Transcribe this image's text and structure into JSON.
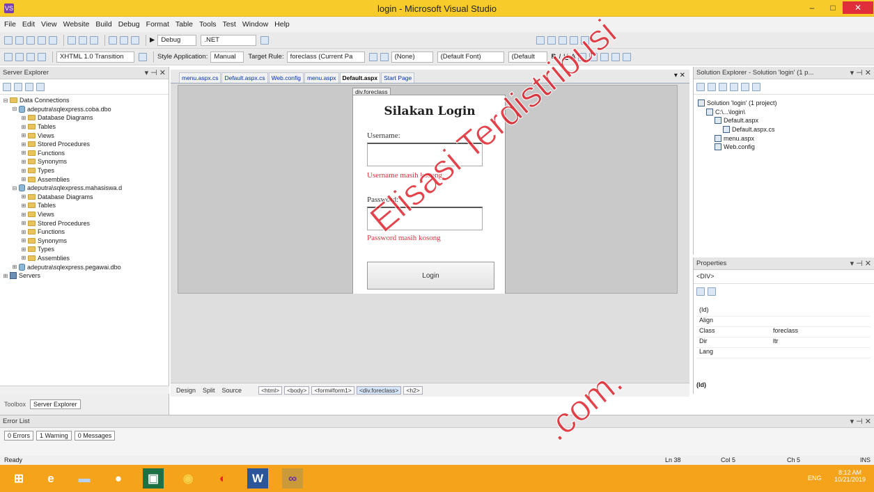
{
  "window": {
    "title": "login - Microsoft Visual Studio",
    "app_icon": "vs-logo",
    "minimize": "–",
    "maximize": "□",
    "close": "✕"
  },
  "menu": [
    "File",
    "Edit",
    "View",
    "Website",
    "Build",
    "Debug",
    "Format",
    "Table",
    "Tools",
    "Test",
    "Window",
    "Help"
  ],
  "toolbar": {
    "config": "Debug",
    "platform": ".NET",
    "doctype": "XHTML 1.0 Transition",
    "style_app_label": "Style Application:",
    "style_app_value": "Manual",
    "target_rule_label": "Target Rule:",
    "target_rule_value": "foreclass (Current Pa",
    "style_none": "(None)",
    "font": "(Default Font)",
    "size": "(Default"
  },
  "server_explorer": {
    "title": "Server Explorer",
    "tree": [
      {
        "indent": 0,
        "exp": "⊟",
        "icon": "folder",
        "label": "Data Connections"
      },
      {
        "indent": 1,
        "exp": "⊟",
        "icon": "db",
        "label": "adeputra\\sqlexpress.coba.dbo"
      },
      {
        "indent": 2,
        "exp": "⊞",
        "icon": "folder",
        "label": "Database Diagrams"
      },
      {
        "indent": 2,
        "exp": "⊞",
        "icon": "folder",
        "label": "Tables"
      },
      {
        "indent": 2,
        "exp": "⊞",
        "icon": "folder",
        "label": "Views"
      },
      {
        "indent": 2,
        "exp": "⊞",
        "icon": "folder",
        "label": "Stored Procedures"
      },
      {
        "indent": 2,
        "exp": "⊞",
        "icon": "folder",
        "label": "Functions"
      },
      {
        "indent": 2,
        "exp": "⊞",
        "icon": "folder",
        "label": "Synonyms"
      },
      {
        "indent": 2,
        "exp": "⊞",
        "icon": "folder",
        "label": "Types"
      },
      {
        "indent": 2,
        "exp": "⊞",
        "icon": "folder",
        "label": "Assemblies"
      },
      {
        "indent": 1,
        "exp": "⊟",
        "icon": "db",
        "label": "adeputra\\sqlexpress.mahasiswa.d"
      },
      {
        "indent": 2,
        "exp": "⊞",
        "icon": "folder",
        "label": "Database Diagrams"
      },
      {
        "indent": 2,
        "exp": "⊞",
        "icon": "folder",
        "label": "Tables"
      },
      {
        "indent": 2,
        "exp": "⊞",
        "icon": "folder",
        "label": "Views"
      },
      {
        "indent": 2,
        "exp": "⊞",
        "icon": "folder",
        "label": "Stored Procedures"
      },
      {
        "indent": 2,
        "exp": "⊞",
        "icon": "folder",
        "label": "Functions"
      },
      {
        "indent": 2,
        "exp": "⊞",
        "icon": "folder",
        "label": "Synonyms"
      },
      {
        "indent": 2,
        "exp": "⊞",
        "icon": "folder",
        "label": "Types"
      },
      {
        "indent": 2,
        "exp": "⊞",
        "icon": "folder",
        "label": "Assemblies"
      },
      {
        "indent": 1,
        "exp": "⊞",
        "icon": "db",
        "label": "adeputra\\sqlexpress.pegawai.dbo"
      },
      {
        "indent": 0,
        "exp": "⊞",
        "icon": "srv",
        "label": "Servers"
      }
    ],
    "bottom_tabs": [
      "Toolbox",
      "Server Explorer"
    ]
  },
  "document": {
    "tabs": [
      "menu.aspx.cs",
      "Default.aspx.cs",
      "Web.config",
      "menu.aspx",
      "Default.aspx",
      "Start Page"
    ],
    "active_tab": "Default.aspx",
    "div_tag": "div.foreclass",
    "login": {
      "title": "Silakan Login",
      "username_label": "Username:",
      "username_error": "Username masih kosong",
      "password_label": "Password:",
      "password_error": "Password masih kosong",
      "button": "Login"
    },
    "views": [
      "Design",
      "Split",
      "Source"
    ],
    "breadcrumbs": [
      "<html>",
      "<body>",
      "<form#form1>",
      "<div.foreclass>",
      "<h2>"
    ]
  },
  "solution_explorer": {
    "title": "Solution Explorer - Solution 'login' (1 p...",
    "tree": [
      {
        "indent": 0,
        "label": "Solution 'login' (1 project)"
      },
      {
        "indent": 1,
        "label": "C:\\...\\login\\"
      },
      {
        "indent": 2,
        "label": "Default.aspx"
      },
      {
        "indent": 3,
        "label": "Default.aspx.cs"
      },
      {
        "indent": 2,
        "label": "menu.aspx"
      },
      {
        "indent": 2,
        "label": "Web.config"
      }
    ]
  },
  "properties": {
    "title": "Properties",
    "object": "<DIV>",
    "rows": [
      {
        "k": "(Id)",
        "v": ""
      },
      {
        "k": "Align",
        "v": ""
      },
      {
        "k": "Class",
        "v": "foreclass"
      },
      {
        "k": "Dir",
        "v": "ltr"
      },
      {
        "k": "Lang",
        "v": ""
      }
    ],
    "footer": "(Id)"
  },
  "error_list": {
    "title": "Error List",
    "errors": "0 Errors",
    "warnings": "1 Warning",
    "messages": "0 Messages"
  },
  "status": {
    "ready": "Ready",
    "ln": "Ln 38",
    "col": "Col 5",
    "ch": "Ch 5",
    "mode": "INS"
  },
  "taskbar": {
    "lang": "ENG",
    "time": "8:12 AM",
    "date": "10/21/2019"
  },
  "watermark": "Elisasi Terdistribusi",
  "watermark2": ".com.",
  "colors": {
    "titlebar": "#f7cb2a",
    "taskbar": "#f5a31a",
    "error_text": "#d8343f"
  }
}
